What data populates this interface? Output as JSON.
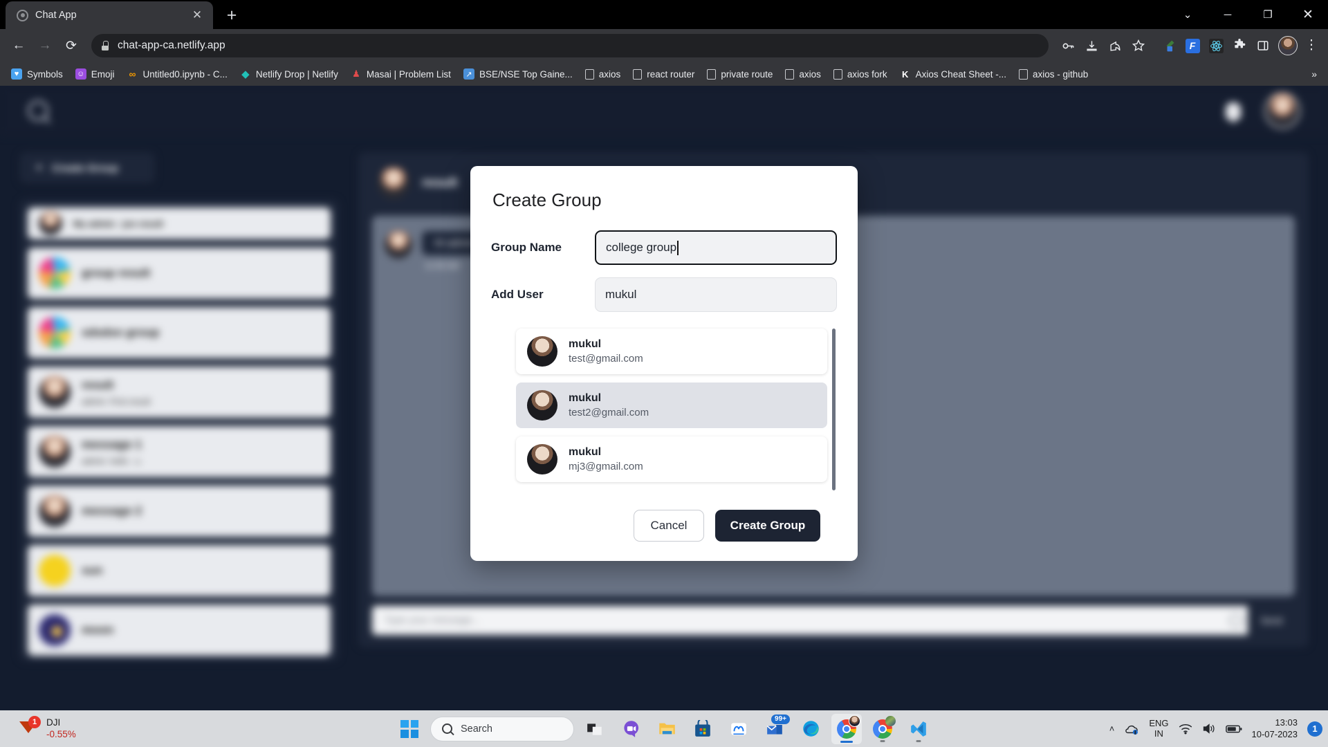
{
  "browser": {
    "tab": {
      "title": "Chat App",
      "favicon": "chat-favicon",
      "close_label": "✕"
    },
    "new_tab_label": "+",
    "window_controls": {
      "collapse": "⌄",
      "minimize": "─",
      "maximize": "❐",
      "close": "✕"
    },
    "nav": {
      "back": "←",
      "forward": "→",
      "reload": "⟳"
    },
    "omnibox": {
      "url": "chat-app-ca.netlify.app",
      "lock_icon": "lock-icon"
    },
    "toolbar_icons": [
      "password-key-icon",
      "install-app-icon",
      "share-icon",
      "bookmark-star-icon",
      "color-picker-icon",
      "flipkart-extension-icon",
      "react-devtools-icon",
      "extensions-puzzle-icon",
      "side-panel-icon",
      "profile-avatar",
      "chrome-menu-icon"
    ],
    "bookmarks": [
      {
        "label": "Symbols",
        "icon": "heart-icon",
        "icon_bg": "#4aa3f0",
        "glyph": "♥"
      },
      {
        "label": "Emoji",
        "icon": "emoji-icon",
        "icon_bg": "#9b4de0",
        "glyph": "☺"
      },
      {
        "label": "Untitled0.ipynb - C...",
        "icon": "colab-icon",
        "icon_bg": "transparent",
        "glyph": "∞"
      },
      {
        "label": "Netlify Drop | Netlify",
        "icon": "netlify-icon",
        "icon_bg": "transparent",
        "glyph": "◆"
      },
      {
        "label": "Masai | Problem List",
        "icon": "masai-icon",
        "icon_bg": "transparent",
        "glyph": "♟"
      },
      {
        "label": "BSE/NSE Top Gaine...",
        "icon": "stocks-icon",
        "icon_bg": "#4a90d9",
        "glyph": "↗"
      },
      {
        "label": "axios",
        "icon": "blank-page-icon",
        "icon_bg": "transparent",
        "glyph": ""
      },
      {
        "label": "react router",
        "icon": "blank-page-icon",
        "icon_bg": "transparent",
        "glyph": ""
      },
      {
        "label": "private route",
        "icon": "blank-page-icon",
        "icon_bg": "transparent",
        "glyph": ""
      },
      {
        "label": "axios",
        "icon": "blank-page-icon",
        "icon_bg": "transparent",
        "glyph": ""
      },
      {
        "label": "axios fork",
        "icon": "blank-page-icon",
        "icon_bg": "transparent",
        "glyph": ""
      },
      {
        "label": "Axios Cheat Sheet -...",
        "icon": "kapeli-icon",
        "icon_bg": "transparent",
        "glyph": "K"
      },
      {
        "label": "axios - github",
        "icon": "blank-page-icon",
        "icon_bg": "transparent",
        "glyph": ""
      }
    ],
    "bookmarks_overflow": "»"
  },
  "app": {
    "header": {
      "search_icon": "search-icon",
      "bell_icon": "notification-bell-icon",
      "avatar": "user-avatar"
    },
    "sidebar": {
      "create_group_button": "Create Group",
      "create_group_plus": "+",
      "chats": [
        {
          "name": "My admin : jon result",
          "sub": "",
          "avatar": "person",
          "compact": true
        },
        {
          "name": "group result",
          "sub": "",
          "avatar": "group",
          "compact": false
        },
        {
          "name": "sdsdsn group",
          "sub": "",
          "avatar": "group",
          "compact": false
        },
        {
          "name": "result",
          "sub": "admin: First result",
          "avatar": "person",
          "compact": false
        },
        {
          "name": "message 1",
          "sub": "admin: hello : u",
          "avatar": "person",
          "compact": false
        },
        {
          "name": "message 2",
          "sub": "",
          "avatar": "person",
          "compact": false
        },
        {
          "name": "sun",
          "sub": "",
          "avatar": "yellow",
          "compact": false
        },
        {
          "name": "moon",
          "sub": "",
          "avatar": "moon",
          "compact": false
        }
      ]
    },
    "chat_panel": {
      "contact_name": "result",
      "messages": [
        {
          "text": "Hi admin",
          "time": "11:55 AM",
          "avatar": "person"
        }
      ],
      "input_placeholder": "Type your message...",
      "emoji_button": "emoji-icon",
      "send_button": "Send"
    }
  },
  "modal": {
    "title": "Create Group",
    "group_name": {
      "label": "Group Name",
      "value": "college group",
      "focused": true
    },
    "add_user": {
      "label": "Add User",
      "value": "mukul",
      "focused": false
    },
    "results": [
      {
        "name": "mukul",
        "email": "test@gmail.com",
        "selected": false
      },
      {
        "name": "mukul",
        "email": "test2@gmail.com",
        "selected": true
      },
      {
        "name": "mukul",
        "email": "mj3@gmail.com",
        "selected": false
      }
    ],
    "cancel_label": "Cancel",
    "submit_label": "Create Group"
  },
  "taskbar": {
    "widget": {
      "name": "DJI",
      "value": "-0.55%",
      "badge": "1"
    },
    "search_placeholder": "Search",
    "apps": [
      "task-view-icon",
      "teams-chat-icon",
      "file-explorer-icon",
      "microsoft-store-icon",
      "meta-icon",
      "mail-icon",
      "edge-icon",
      "chrome-active-icon",
      "chrome-icon",
      "vscode-icon"
    ],
    "mail_badge": "99+",
    "tray": {
      "chevron": "˄",
      "cloud_icon": "onedrive-icon",
      "language_top": "ENG",
      "language_bottom": "IN",
      "wifi_icon": "wifi-icon",
      "volume_icon": "volume-icon",
      "battery_icon": "battery-icon",
      "time": "13:03",
      "date": "10-07-2023",
      "notification_count": "1"
    }
  }
}
